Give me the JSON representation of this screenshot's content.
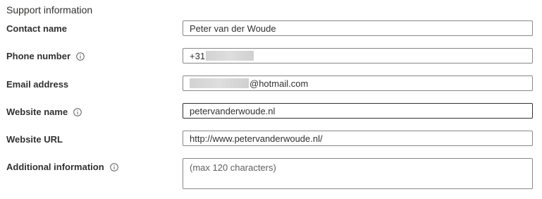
{
  "section": {
    "title": "Support information"
  },
  "fields": {
    "contact_name": {
      "label": "Contact name",
      "value": "Peter van der Woude"
    },
    "phone_number": {
      "label": "Phone number",
      "value_prefix": "+31",
      "value_redacted": true
    },
    "email_address": {
      "label": "Email address",
      "value_redacted": true,
      "value_suffix": "@hotmail.com"
    },
    "website_name": {
      "label": "Website name",
      "value": "petervanderwoude.nl"
    },
    "website_url": {
      "label": "Website URL",
      "value": "http://www.petervanderwoude.nl/"
    },
    "additional_information": {
      "label": "Additional information",
      "placeholder": "(max 120 characters)"
    }
  },
  "icons": {
    "info": "info-circle-icon"
  },
  "colors": {
    "text": "#323130",
    "border": "#8a8886",
    "border_focused": "#323130",
    "placeholder": "#605e5c",
    "redaction": "#d6d6d6"
  }
}
